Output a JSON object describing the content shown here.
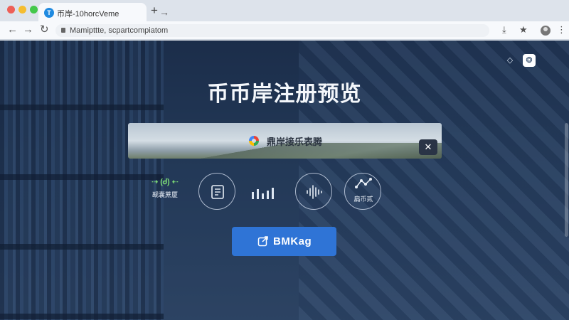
{
  "browser": {
    "tab": {
      "title": "币岸-10horcVeme",
      "favicon": "app-favicon"
    },
    "url": "Mamipttte, scpartcompiatom",
    "toolbar_icons": [
      "back-icon",
      "forward-icon",
      "reload-icon",
      "lock-icon",
      "download-icon",
      "star-icon",
      "profile-icon",
      "menu-icon"
    ]
  },
  "page": {
    "title": "币币岸注册预览",
    "banner": {
      "text": "鼎岸接乐表腾",
      "close_symbol": "✕"
    },
    "features": [
      {
        "name": "qa-feature",
        "label": "觋囊蔗厦",
        "icon_text": "⇢ (Ꮷ) ⇠"
      },
      {
        "name": "document-feature",
        "icon": "document-icon"
      },
      {
        "name": "equalizer-feature",
        "icon": "equalizer-icon"
      },
      {
        "name": "audio-wave-feature",
        "icon": "audio-wave-icon"
      },
      {
        "name": "network-feature",
        "label": "扁币贰",
        "icon": "network-icon"
      }
    ],
    "cta": {
      "label": "BMKag",
      "icon": "external-edit-icon",
      "color": "#2f74d6"
    }
  },
  "colors": {
    "background_dark": "#203452",
    "accent": "#2f74d6"
  }
}
